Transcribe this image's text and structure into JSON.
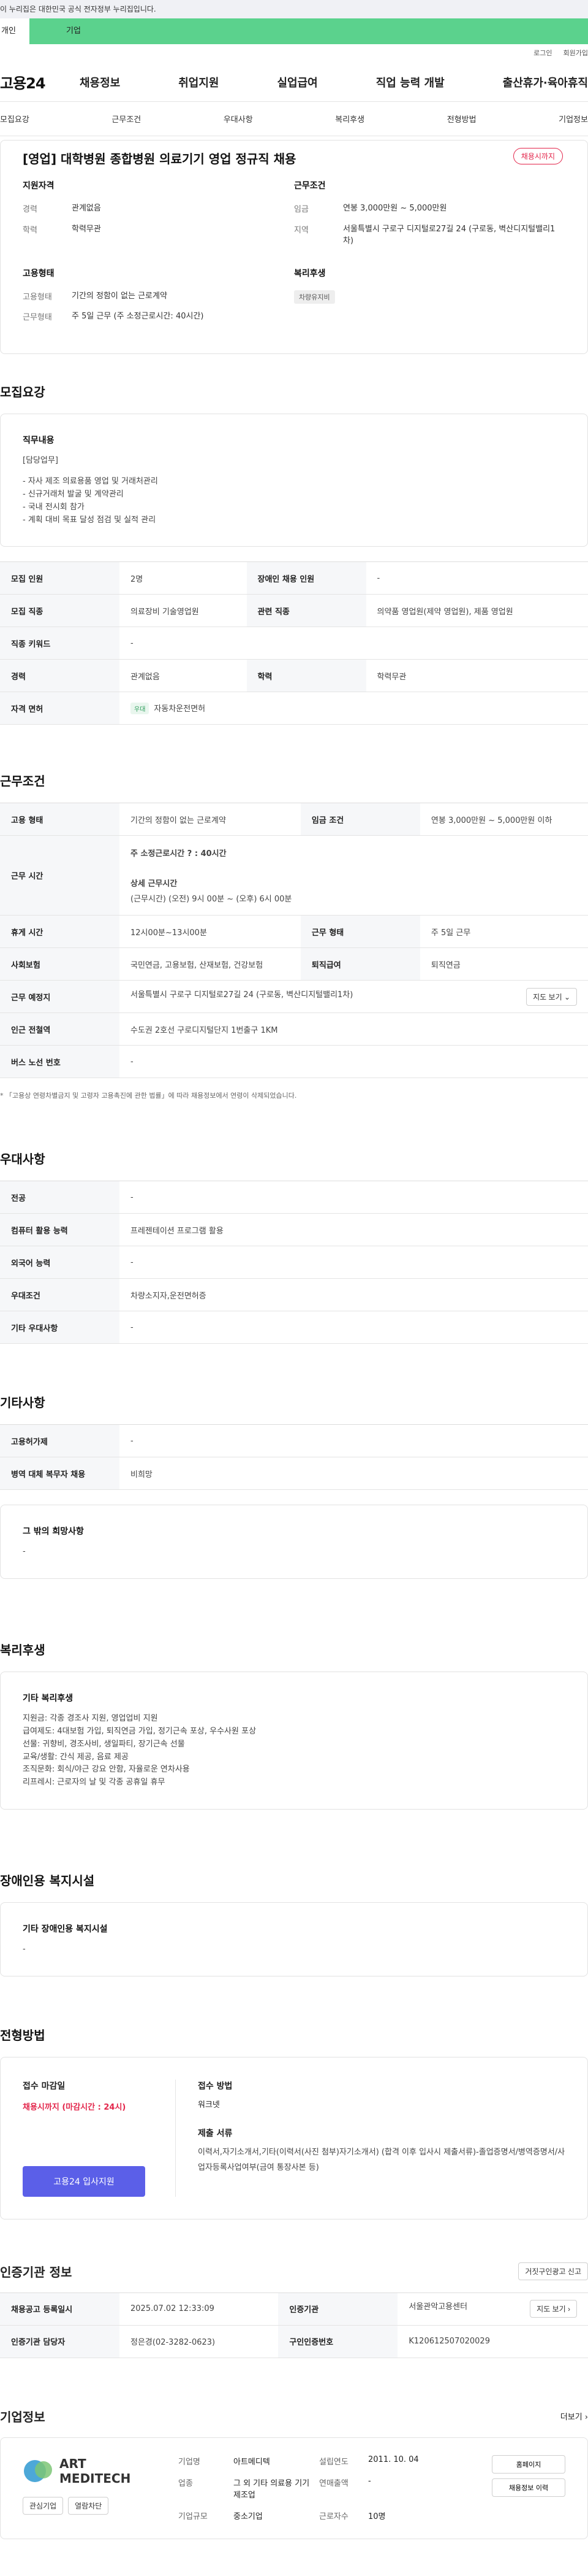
{
  "banner": {
    "text": "이 누리집은 대한민국 공식 전자정부 누리집입니다."
  },
  "top_tabs": {
    "individual": "개인",
    "company": "기업"
  },
  "util": {
    "login": "로그인",
    "join": "회원가입"
  },
  "logo": "고용24",
  "gnb": [
    "채용정보",
    "취업지원",
    "실업급여",
    "직업 능력 개발",
    "출산휴가·육아휴직"
  ],
  "lnb": [
    "모집요강",
    "근무조건",
    "우대사항",
    "복리후생",
    "전형방법",
    "기업정보"
  ],
  "summary": {
    "title": "[영업] 대학병원 종합병원 의료기기 영업 정규직 채용",
    "badge": "채용시까지",
    "qual_title": "지원자격",
    "cond_title": "근무조건",
    "career_k": "경력",
    "career_v": "관계없음",
    "edu_k": "학력",
    "edu_v": "학력무관",
    "wage_k": "임금",
    "wage_v": "연봉 3,000만원 ~ 5,000만원",
    "area_k": "지역",
    "area_v": "서울특별시 구로구 디지털로27길 24 (구로동, 벽산디지털밸리1차)",
    "emp_title": "고용형태",
    "welfare_title": "복리후생",
    "emptype_k": "고용형태",
    "emptype_v": "기간의 정함이 없는 근로계약",
    "worktype_k": "근무형태",
    "worktype_v": "주 5일 근무 (주 소정근로시간: 40시간)",
    "welfare_pill": "차량유지비"
  },
  "recruit": {
    "title": "모집요강",
    "duty_title": "직무내용",
    "duty_lines": [
      "[담당업무]",
      "",
      "- 자사 제조 의료용품 영업 및 거래처관리",
      "- 신규거래처 발굴 및 계약관리",
      "- 국내 전시회 참가",
      "- 계획 대비 목표 달성 점검 및 실적 관리"
    ],
    "rows": {
      "count_k": "모집 인원",
      "count_v": "2명",
      "disabled_k": "장애인 채용 인원",
      "disabled_v": "-",
      "job_k": "모집 직종",
      "job_v": "의료장비 기술영업원",
      "related_k": "관련 직종",
      "related_v": "의약품 영업원(제약 영업원), 제품 영업원",
      "keyword_k": "직종 키워드",
      "keyword_v": "-",
      "career_k": "경력",
      "career_v": "관계없음",
      "edu_k": "학력",
      "edu_v": "학력무관",
      "lic_k": "자격 면허",
      "lic_pill": "우대",
      "lic_v": "자동차운전면허"
    }
  },
  "work": {
    "title": "근무조건",
    "emptype_k": "고용 형태",
    "emptype_v": "기간의 정함이 없는 근로계약",
    "wage_k": "임금 조건",
    "wage_v": "연봉 3,000만원 ~ 5,000만원 이하",
    "hours_k": "근무 시간",
    "hours_weekly": "주 소정근로시간 ? : 40시간",
    "hours_detail_title": "상세 근무시간",
    "hours_detail": "(근무시간) (오전) 9시 00분 ~ (오후) 6시 00분",
    "rest_k": "휴게 시간",
    "rest_v": "12시00분~13시00분",
    "form_k": "근무 형태",
    "form_v": "주 5일 근무",
    "ins_k": "사회보험",
    "ins_v": "국민연금, 고용보험, 산재보험, 건강보험",
    "retire_k": "퇴직급여",
    "retire_v": "퇴직연금",
    "place_k": "근무 예정지",
    "place_v": "서울특별시 구로구 디지털로27길 24 (구로동, 벽산디지털밸리1차)",
    "map_btn": "지도 보기 ⌄",
    "subway_k": "인근 전철역",
    "subway_v": "수도권 2호선 구로디지털단지 1번출구 1KM",
    "bus_k": "버스 노선 번호",
    "bus_v": "-",
    "note": "* 「고용상 연령차별금지 및 고령자 고용촉진에 관한 법률」에 따라 채용정보에서 연령이 삭제되었습니다."
  },
  "pref": {
    "title": "우대사항",
    "major_k": "전공",
    "major_v": "-",
    "pc_k": "컴퓨터 활용 능력",
    "pc_v": "프레젠테이션 프로그램 활용",
    "lang_k": "외국어 능력",
    "lang_v": "-",
    "cond_k": "우대조건",
    "cond_v": "차량소지자,운전면허증",
    "etc_k": "기타 우대사항",
    "etc_v": "-"
  },
  "other": {
    "title": "기타사항",
    "support_k": "고용허가제",
    "support_v": "-",
    "military_k": "병역 대체 복무자 채용",
    "military_v": "비희망",
    "hope_title": "그 밖의 희망사항",
    "hope_v": "-"
  },
  "welfare": {
    "title": "복리후생",
    "sub": "기타 복리후생",
    "lines": [
      "지원금: 각종 경조사 지원, 영업업비 지원",
      "급여제도: 4대보험 가입, 퇴직연금 가입, 정기근속 포상, 우수사원 포상",
      "선물: 귀향비, 경조사비, 생일파티, 장기근속 선물",
      "교육/생활: 간식 제공, 음료 제공",
      "조직문화: 회식/야근 강요 안함, 자율로운 연차사용",
      "리프레시: 근로자의 날 및 각종 공휴일 휴무"
    ]
  },
  "disabled_fac": {
    "title": "장애인용 복지시설",
    "sub": "기타 장애인용 복지시설",
    "v": "-"
  },
  "method": {
    "title": "전형방법",
    "deadline_k": "접수 마감일",
    "deadline_v": "채용시까지 (마감시간 : 24시)",
    "way_k": "접수 방법",
    "way_v": "워크넷",
    "docs_k": "제출 서류",
    "docs_v": "이력서,자기소개서,기타(이력서(사진 첨부)자기소개서) (합격 이후 입사시 제출서류)-졸업증명서/병역증명서/사업자등록사업여부(금여 통장사본 등)",
    "apply_btn": "고용24 입사지원"
  },
  "cert": {
    "title": "인증기관 정보",
    "btn": "거짓구인광고 신고",
    "date_k": "채용공고 등록일시",
    "date_v": "2025.07.02 12:33:09",
    "org_k": "인증기관",
    "org_v": "서울관악고용센터",
    "map_btn": "지도 보기 ›",
    "mgr_k": "인증기관 담당자",
    "mgr_v": "정은경(02-3282-0623)",
    "num_k": "구인인증번호",
    "num_v": "K120612507020029"
  },
  "company": {
    "title": "기업정보",
    "more": "더보기 ›",
    "logo_text": [
      "ART",
      "MEDITECH"
    ],
    "name_k": "기업명",
    "name_v": "아트메디텍",
    "est_k": "설립연도",
    "est_v": "2011. 10. 04",
    "ind_k": "업종",
    "ind_v": "그 외 기타 의료용 기기 제조업",
    "sales_k": "연매출액",
    "sales_v": "-",
    "size_k": "기업규모",
    "size_v": "중소기업",
    "emp_k": "근로자수",
    "emp_v": "10명",
    "btn_home": "홈페이지",
    "btn_info": "채용정보 이력",
    "btn_fav": "관심기업",
    "btn_block": "열람차단"
  }
}
